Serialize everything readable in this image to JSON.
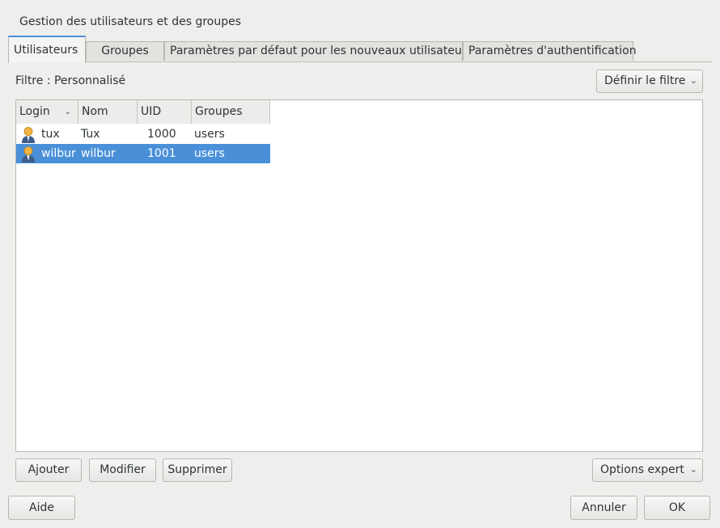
{
  "window": {
    "title": "Gestion des utilisateurs et des groupes"
  },
  "tabs": [
    {
      "label": "Utilisateurs",
      "active": true
    },
    {
      "label": "Groupes",
      "active": false
    },
    {
      "label": "Paramètres par défaut pour les nouveaux utilisateurs",
      "active": false
    },
    {
      "label": "Paramètres d'authentification",
      "active": false
    }
  ],
  "filter": {
    "label": "Filtre : Personnalisé",
    "button_label": "Définir le filtre"
  },
  "table": {
    "columns": [
      "Login",
      "Nom",
      "UID",
      "Groupes"
    ],
    "sort_column": "Login",
    "rows": [
      {
        "login": "tux",
        "name": "Tux",
        "uid": "1000",
        "groups": "users",
        "selected": false,
        "icon": "user-icon"
      },
      {
        "login": "wilbur",
        "name": "wilbur",
        "uid": "1001",
        "groups": "users",
        "selected": true,
        "icon": "user-icon"
      }
    ]
  },
  "actions": {
    "add_label": "Ajouter",
    "edit_label": "Modifier",
    "delete_label": "Supprimer",
    "expert_label": "Options expert"
  },
  "footer": {
    "help_label": "Aide",
    "cancel_label": "Annuler",
    "ok_label": "OK"
  },
  "colors": {
    "accent": "#4a90d9",
    "background": "#eeeeec",
    "selected_row_text": "#ffffff"
  }
}
